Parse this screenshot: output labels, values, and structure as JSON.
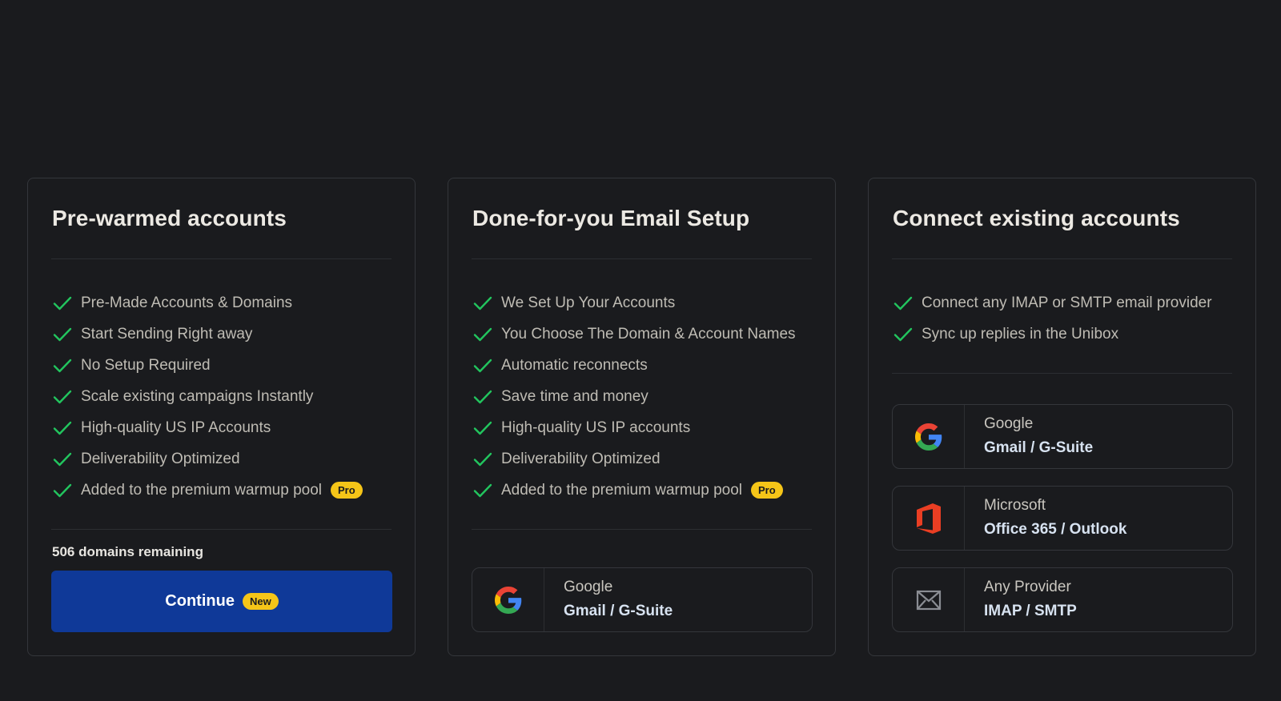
{
  "cards": [
    {
      "title": "Pre-warmed accounts",
      "features": [
        "Pre-Made Accounts & Domains",
        "Start Sending Right away",
        "No Setup Required",
        "Scale existing campaigns Instantly",
        "High-quality US IP Accounts",
        "Deliverability Optimized",
        "Added to the premium warmup pool"
      ],
      "pro_badge": "Pro",
      "remaining": "506 domains remaining",
      "continue_label": "Continue",
      "new_badge": "New"
    },
    {
      "title": "Done-for-you Email Setup",
      "features": [
        "We Set Up Your Accounts",
        "You Choose The Domain & Account Names",
        "Automatic reconnects",
        "Save time and money",
        "High-quality US IP accounts",
        "Deliverability Optimized",
        "Added to the premium warmup pool"
      ],
      "pro_badge": "Pro",
      "providers": [
        {
          "name": "Google",
          "product": "Gmail / G-Suite",
          "icon": "google-icon"
        }
      ]
    },
    {
      "title": "Connect existing accounts",
      "features": [
        "Connect any IMAP or SMTP email provider",
        "Sync up replies in the Unibox"
      ],
      "providers": [
        {
          "name": "Google",
          "product": "Gmail / G-Suite",
          "icon": "google-icon"
        },
        {
          "name": "Microsoft",
          "product": "Office 365 / Outlook",
          "icon": "office-icon"
        },
        {
          "name": "Any Provider",
          "product": "IMAP / SMTP",
          "icon": "mail-icon"
        }
      ]
    }
  ],
  "colors": {
    "background": "#1a1b1e",
    "check": "#22c55e",
    "badge": "#f5c518",
    "continue_button": "#0f3998",
    "office_red": "#ea3e23"
  }
}
